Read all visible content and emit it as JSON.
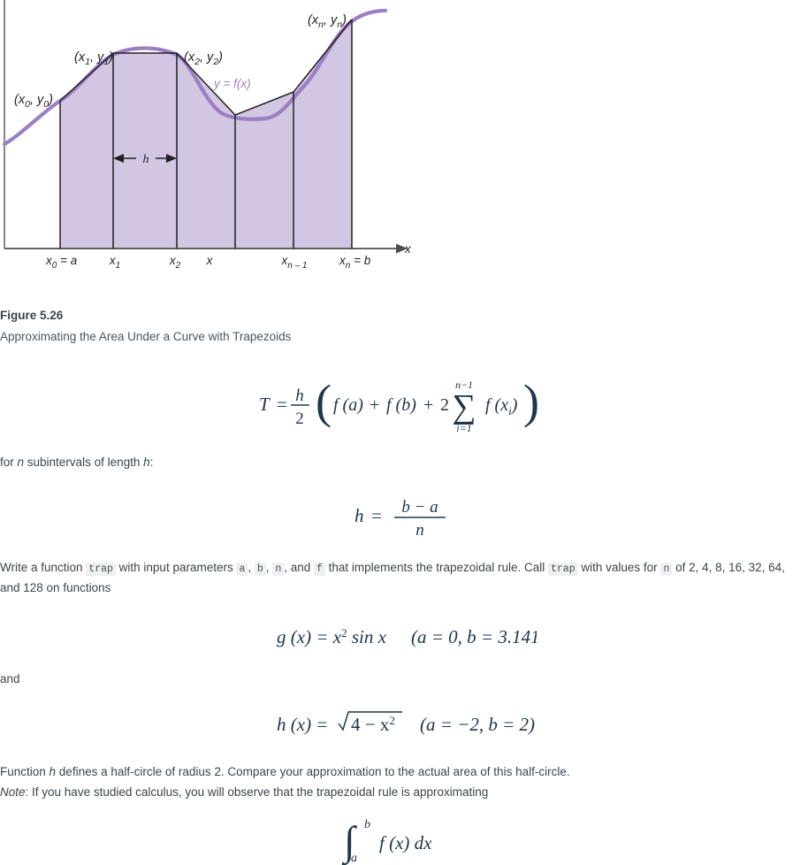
{
  "figure": {
    "caption_number": "Figure 5.26",
    "caption_title": "Approximating the Area Under a Curve with Trapezoids",
    "curve_label": "y = f(x)",
    "axis_label_x": "x",
    "interval_label": "h",
    "point_labels": [
      {
        "id": "p0",
        "text": "(x0, y0)",
        "base": "(x",
        "sub": "0",
        "mid": ", y",
        "sub2": "0",
        "close": ")"
      },
      {
        "id": "p1",
        "text": "(x1, y1)",
        "base": "(x",
        "sub": "1",
        "mid": ", y",
        "sub2": "1",
        "close": ")"
      },
      {
        "id": "p2",
        "text": "(x2, y2)",
        "base": "(x",
        "sub": "2",
        "mid": ", y",
        "sub2": "2",
        "close": ")"
      },
      {
        "id": "pn",
        "text": "(xn, yn)",
        "base": "(x",
        "sub": "n",
        "mid": ", y",
        "sub2": "n",
        "close": ")"
      }
    ],
    "x_tick_labels": [
      {
        "base": "x",
        "sub": "0",
        "tail": " = a"
      },
      {
        "base": "x",
        "sub": "1",
        "tail": ""
      },
      {
        "base": "x",
        "sub": "2",
        "tail": ""
      },
      {
        "base": "x",
        "sub": "",
        "tail": ""
      },
      {
        "base": "x",
        "sub": "n − 1",
        "tail": ""
      },
      {
        "base": "x",
        "sub": "n",
        "tail": " = b"
      }
    ],
    "colors": {
      "curve": "#9b7fc4",
      "fill": "#d3c6e2",
      "chord": "#231f20",
      "axis": "#4d4d4d",
      "label_text": "#231f20"
    }
  },
  "formulas": {
    "trapezoid_rule": {
      "lhs": "T",
      "eq": "=",
      "frac_num": "h",
      "frac_den": "2",
      "term1": "f (a)",
      "plus1": "+",
      "term2": "f (b)",
      "plus2": "+",
      "coef": "2",
      "sum_symbol": "∑",
      "sum_upper": "n−1",
      "sum_lower": "i=1",
      "sum_term": "f (x",
      "sum_term_sub": "i",
      "sum_term_close": ")"
    },
    "h_definition": {
      "lhs": "h",
      "eq": "=",
      "num": "b − a",
      "den": "n"
    },
    "g_function": {
      "text": "g (x) = x",
      "sup": "2",
      "text2": " sin x",
      "bounds": "(a = 0, b = 3.14159)"
    },
    "h_function": {
      "text": "h (x) = ",
      "radicand_a": "4 − x",
      "radicand_sup": "2",
      "bounds": "(a = −2, b = 2)"
    },
    "integral": {
      "symbol": "∫",
      "upper": "b",
      "lower": "a",
      "integrand": "f (x) dx"
    }
  },
  "text": {
    "subintervals_prefix": "for ",
    "subintervals_n": "n",
    "subintervals_mid": " subintervals of length ",
    "subintervals_h": "h",
    "subintervals_suffix": ":",
    "task_1": "Write a function ",
    "code_trap_1": "trap",
    "task_2": " with input parameters ",
    "code_a": "a",
    "task_comma1": ", ",
    "code_b": "b",
    "task_comma2": ", ",
    "code_n": "n",
    "task_3": ", and ",
    "code_f": "f",
    "task_4": " that implements the trapezoidal rule. Call ",
    "code_trap_2": "trap",
    "task_5": " with values for ",
    "code_n_2": "n",
    "task_6": " of 2, 4, 8, 16, 32, 64, and 128 on functions",
    "and_word": "and",
    "halfcircle_1": "Function ",
    "halfcircle_h": "h",
    "halfcircle_2": " defines a half-circle of radius 2. Compare your approximation to the actual area of this half-circle.",
    "note_label": "Note",
    "note_body": ": If you have studied calculus, you will observe that the trapezoidal rule is approximating"
  }
}
